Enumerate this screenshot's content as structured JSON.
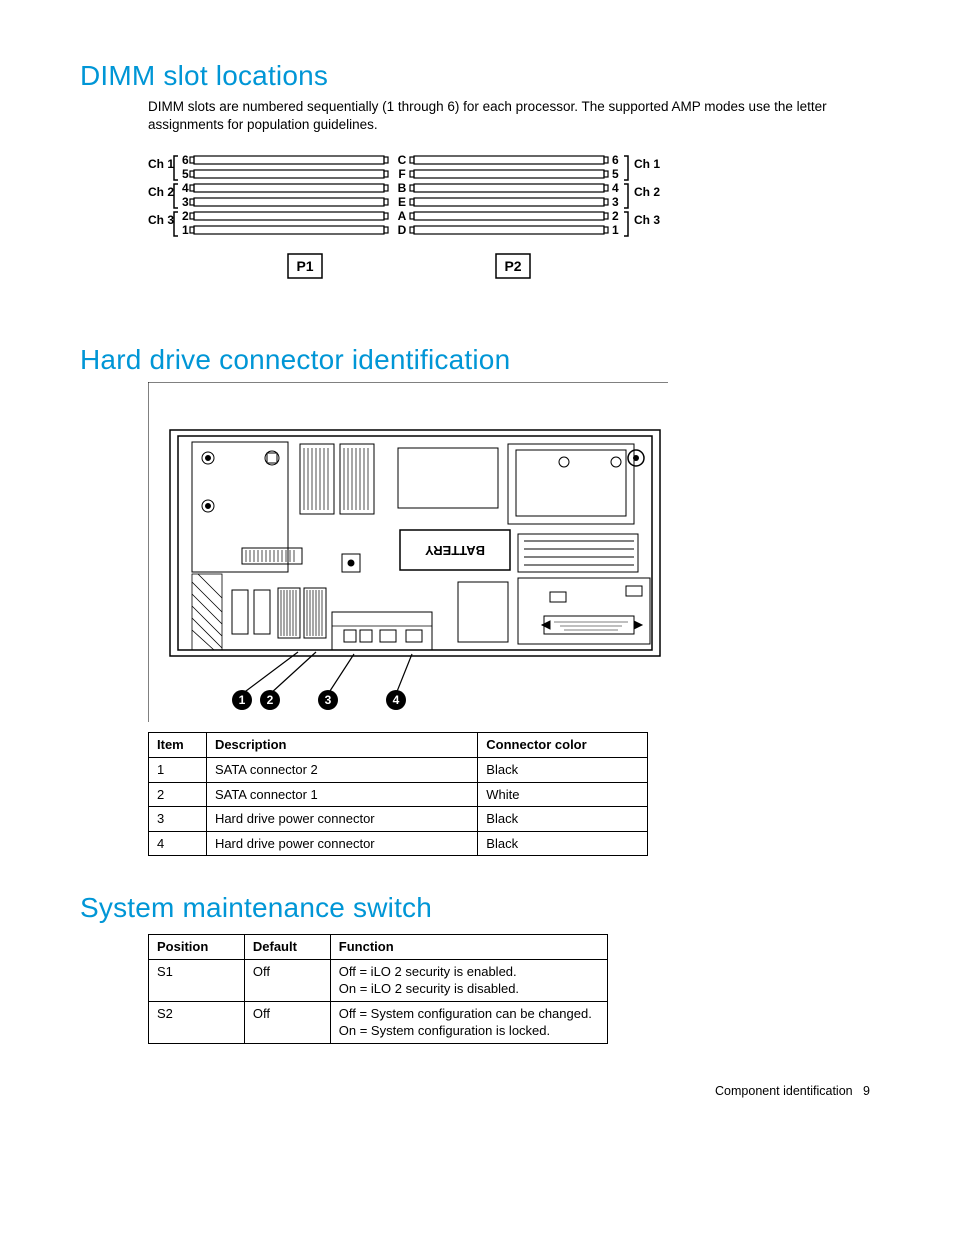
{
  "sections": {
    "dimm": {
      "heading": "DIMM slot locations",
      "body": "DIMM slots are numbered sequentially (1 through 6) for each processor. The supported AMP modes use the letter assignments for population guidelines.",
      "left_channels": [
        "Ch 1",
        "Ch 2",
        "Ch 3"
      ],
      "right_channels": [
        "Ch 1",
        "Ch 2",
        "Ch 3"
      ],
      "left_numbers": [
        "6",
        "5",
        "4",
        "3",
        "2",
        "1"
      ],
      "center_letters": [
        "C",
        "F",
        "B",
        "E",
        "A",
        "D"
      ],
      "right_numbers": [
        "6",
        "5",
        "4",
        "3",
        "2",
        "1"
      ],
      "p1": "P1",
      "p2": "P2"
    },
    "hd": {
      "heading": "Hard drive connector identification",
      "battery_label": "BATTERY",
      "callouts": [
        "1",
        "2",
        "3",
        "4"
      ],
      "table": {
        "headers": [
          "Item",
          "Description",
          "Connector color"
        ],
        "rows": [
          {
            "item": "1",
            "desc": "SATA connector 2",
            "color": "Black"
          },
          {
            "item": "2",
            "desc": "SATA connector 1",
            "color": "White"
          },
          {
            "item": "3",
            "desc": "Hard drive power connector",
            "color": "Black"
          },
          {
            "item": "4",
            "desc": "Hard drive power connector",
            "color": "Black"
          }
        ]
      }
    },
    "sms": {
      "heading": "System maintenance switch",
      "table": {
        "headers": [
          "Position",
          "Default",
          "Function"
        ],
        "rows": [
          {
            "pos": "S1",
            "def": "Off",
            "func": "Off = iLO 2 security is enabled.\nOn = iLO 2 security is disabled."
          },
          {
            "pos": "S2",
            "def": "Off",
            "func": "Off = System configuration can be changed.\nOn = System configuration is locked."
          }
        ]
      }
    }
  },
  "footer": {
    "section": "Component identification",
    "page": "9"
  }
}
